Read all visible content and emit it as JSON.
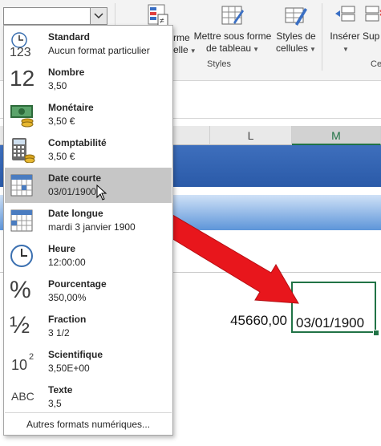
{
  "ribbon": {
    "btn_partial_label_1": "rme",
    "btn_partial_label_2": "elle",
    "format_table_line1": "Mettre sous forme",
    "format_table_line2": "de tableau",
    "cell_styles_line1": "Styles de",
    "cell_styles_line2": "cellules",
    "insert_label": "Insérer",
    "delete_partial_label": "Sup",
    "styles_group": "Styles",
    "cells_group_partial": "Ce"
  },
  "grid": {
    "col_L": "L",
    "col_M": "M",
    "value_L": "45660,00",
    "value_M": "03/01/1900"
  },
  "dropdown": {
    "items": [
      {
        "name": "Standard",
        "example": "Aucun format particulier",
        "icon": "clock-123-icon"
      },
      {
        "name": "Nombre",
        "example": "3,50",
        "icon": "number-12-icon"
      },
      {
        "name": "Monétaire",
        "example": "3,50 €",
        "icon": "currency-icon"
      },
      {
        "name": "Comptabilité",
        "example": " 3,50 €",
        "icon": "calculator-icon"
      },
      {
        "name": "Date courte",
        "example": "03/01/1900",
        "icon": "calendar-short-icon"
      },
      {
        "name": "Date longue",
        "example": "mardi 3 janvier 1900",
        "icon": "calendar-long-icon"
      },
      {
        "name": "Heure",
        "example": "12:00:00",
        "icon": "clock-icon"
      },
      {
        "name": "Pourcentage",
        "example": "350,00%",
        "icon": "percent-icon"
      },
      {
        "name": "Fraction",
        "example": "3 1/2",
        "icon": "fraction-icon"
      },
      {
        "name": "Scientifique",
        "example": "3,50E+00",
        "icon": "scientific-icon"
      },
      {
        "name": "Texte",
        "example": "3,5",
        "icon": "text-abc-icon"
      }
    ],
    "icon_text": {
      "std": "123",
      "num": "12",
      "pct": "%",
      "frac": "½",
      "sci_base": "10",
      "sci_exp": "2",
      "txt": "ABC"
    },
    "more_formats": "Autres formats numériques..."
  },
  "colors": {
    "excel_green": "#217346",
    "arrow_red": "#e8161c",
    "hover_gray": "#c6c6c6"
  }
}
